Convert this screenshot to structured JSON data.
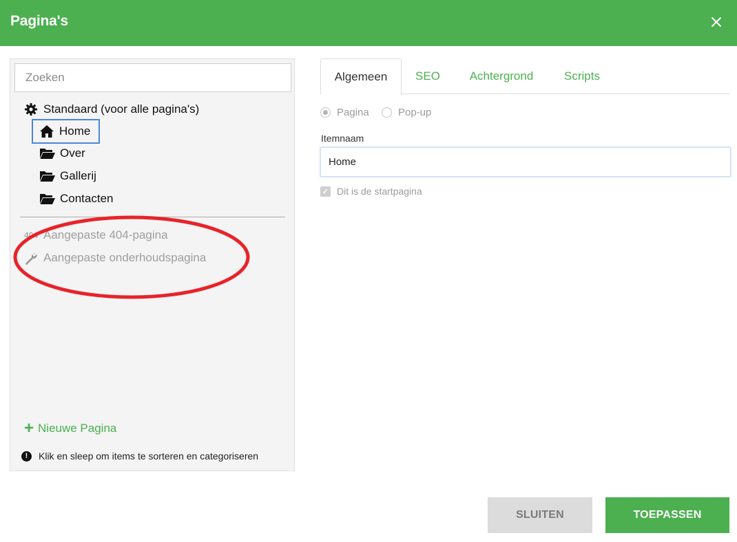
{
  "header": {
    "title": "Pagina's",
    "close_icon": "close-icon"
  },
  "search": {
    "placeholder": "Zoeken"
  },
  "tree": {
    "root": {
      "label": "Standaard (voor alle pagina's)",
      "icon": "gear-icon"
    },
    "pages": [
      {
        "label": "Home",
        "icon": "home-icon",
        "selected": true
      },
      {
        "label": "Over",
        "icon": "folder-open-icon"
      },
      {
        "label": "Gallerij",
        "icon": "folder-open-icon"
      },
      {
        "label": "Contacten",
        "icon": "folder-open-icon"
      }
    ],
    "special": [
      {
        "label": "Aangepaste 404-pagina",
        "icon_text": "404",
        "icon": "404-icon"
      },
      {
        "label": "Aangepaste onderhoudspagina",
        "icon": "wrench-icon"
      }
    ]
  },
  "new_page": {
    "label": "Nieuwe Pagina",
    "icon": "plus-icon"
  },
  "hint": {
    "text": "Klik en sleep om items te sorteren en categoriseren",
    "icon": "info-icon"
  },
  "tabs": [
    {
      "label": "Algemeen",
      "active": true
    },
    {
      "label": "SEO"
    },
    {
      "label": "Achtergrond"
    },
    {
      "label": "Scripts"
    }
  ],
  "type_options": [
    {
      "label": "Pagina",
      "checked": true
    },
    {
      "label": "Pop-up",
      "checked": false
    }
  ],
  "item_name": {
    "label": "Itemnaam",
    "value": "Home"
  },
  "start_page": {
    "label": "Dit is de startpagina",
    "checked": true
  },
  "buttons": {
    "close": "SLUITEN",
    "apply": "TOEPASSEN"
  },
  "colors": {
    "brand": "#4caf50",
    "selection_border": "#4a86d9",
    "annotation": "#e8232a"
  }
}
